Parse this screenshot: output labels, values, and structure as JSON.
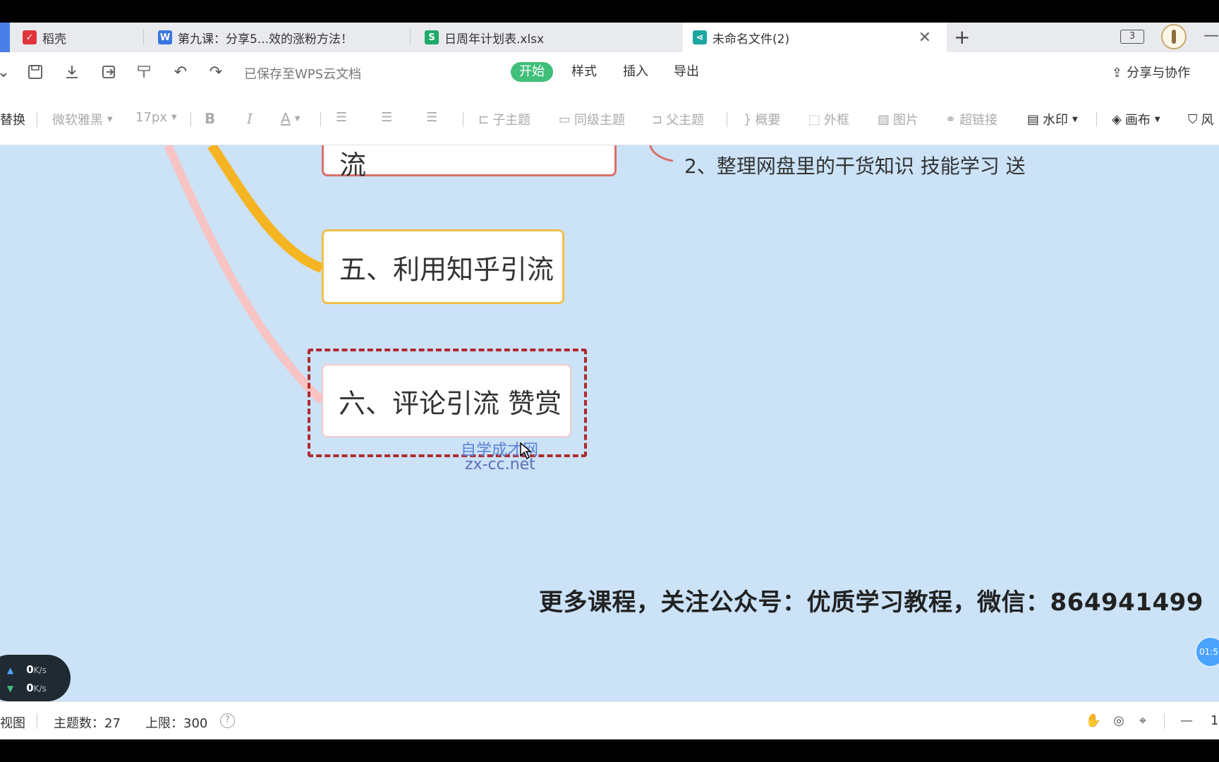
{
  "tabs": [
    {
      "label": "稻壳",
      "icon": "daoke-icon",
      "color": "#e0353b",
      "glyph": "D"
    },
    {
      "label": "第九课：分享5...效的涨粉方法！",
      "icon": "wps-writer-icon",
      "color": "#3a76e0",
      "glyph": "W"
    },
    {
      "label": "日周年计划表.xlsx",
      "icon": "wps-sheet-icon",
      "color": "#1fab6a",
      "glyph": "S"
    },
    {
      "label": "未命名文件(2)",
      "icon": "mindmap-icon",
      "color": "#1aa7a0",
      "glyph": "<"
    }
  ],
  "tab_count": "3",
  "toolbar": {
    "saved_status": "已保存至WPS云文档",
    "menu": [
      "开始",
      "样式",
      "插入",
      "导出"
    ],
    "share_label": "分享与协作"
  },
  "formatbar": {
    "replace": "替换",
    "font_family": "微软雅黑",
    "font_size": "17px",
    "bold": "B",
    "italic": "I",
    "font_color": "A",
    "child_topic": "子主题",
    "sibling_topic": "同级主题",
    "parent_topic": "父主题",
    "summary": "概要",
    "frame": "外框",
    "image": "图片",
    "hyperlink": "超链接",
    "watermark": "水印",
    "canvas": "画布",
    "style_cut": "风"
  },
  "canvas": {
    "node_top_partial": "四、利用个人文件夹引流",
    "node_5": "五、利用知乎引流",
    "node_6": "六、评论引流 赞赏",
    "subtopic": "2、整理网盘里的干货知识 技能学习 送",
    "watermark_line1": "自学成才网",
    "watermark_line2": "zx-cc.net",
    "promo": "更多课程，关注公众号：优质学习教程，微信：864941499",
    "timer": "01:5",
    "branch_colors": {
      "pink": "#f7c3c3",
      "yellow": "#f5b421",
      "red": "#d9706a",
      "frame": "#b02a30"
    }
  },
  "net_speed": {
    "up": "0",
    "down": "0",
    "unit": "K/s"
  },
  "statusbar": {
    "view_label": "视图",
    "topic_count": "主题数：27",
    "limit": "上限：300",
    "zoom_partial": "1"
  }
}
